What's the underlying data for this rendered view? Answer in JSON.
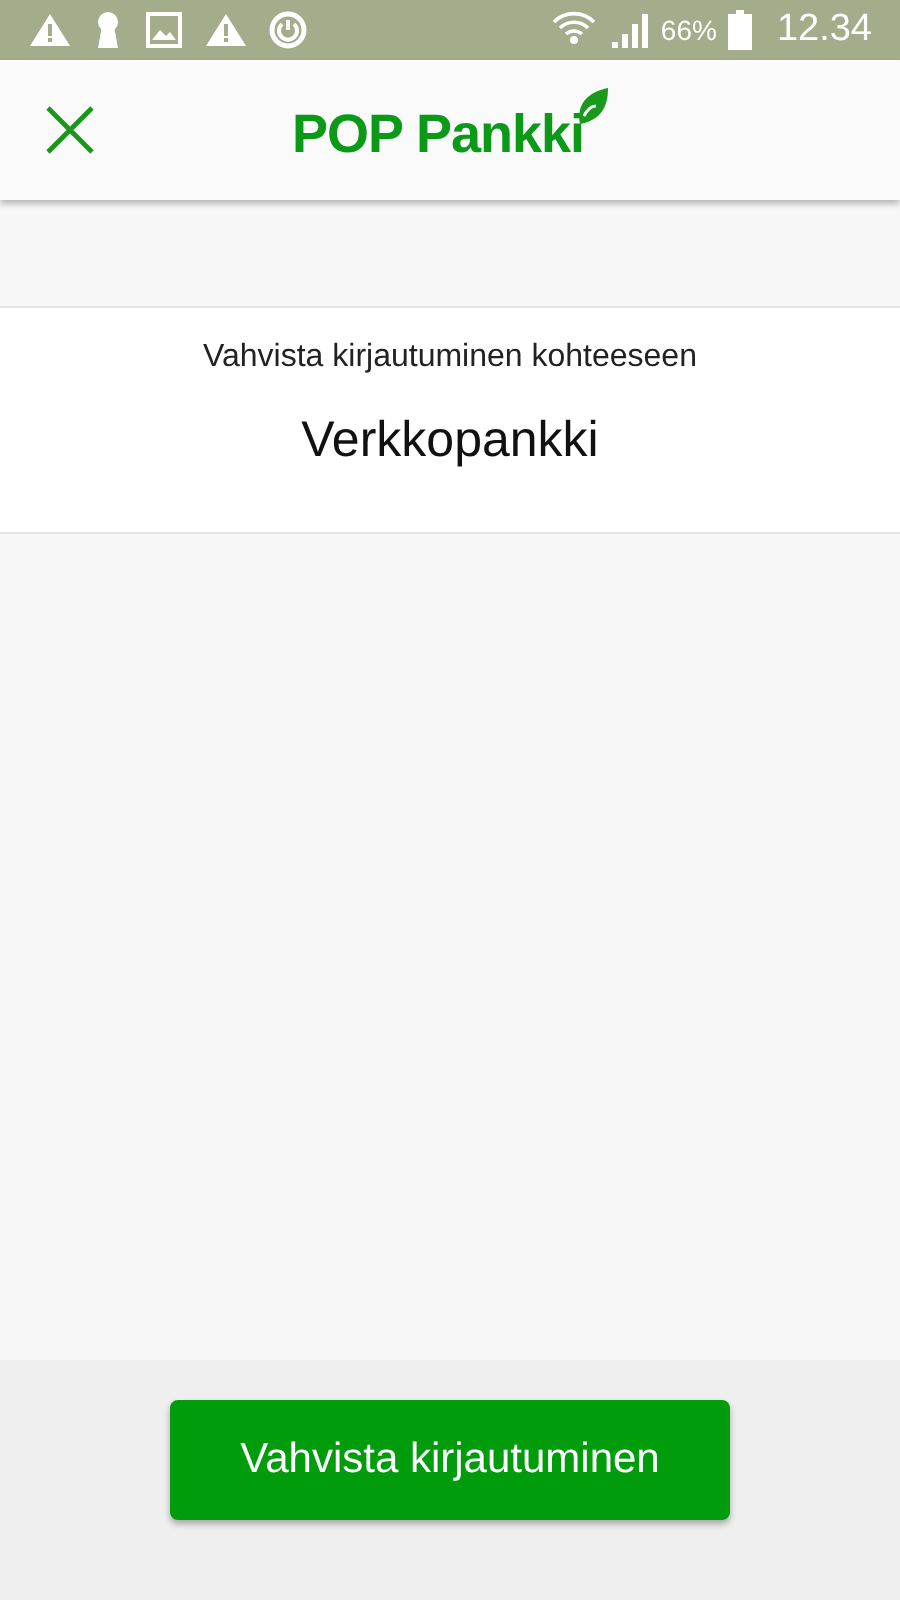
{
  "status_bar": {
    "battery_text": "66%",
    "time": "12.34"
  },
  "header": {
    "logo": "POP Pankki"
  },
  "confirm": {
    "prompt": "Vahvista kirjautuminen kohteeseen",
    "target": "Verkkopankki"
  },
  "button": {
    "label": "Vahvista kirjautuminen"
  }
}
